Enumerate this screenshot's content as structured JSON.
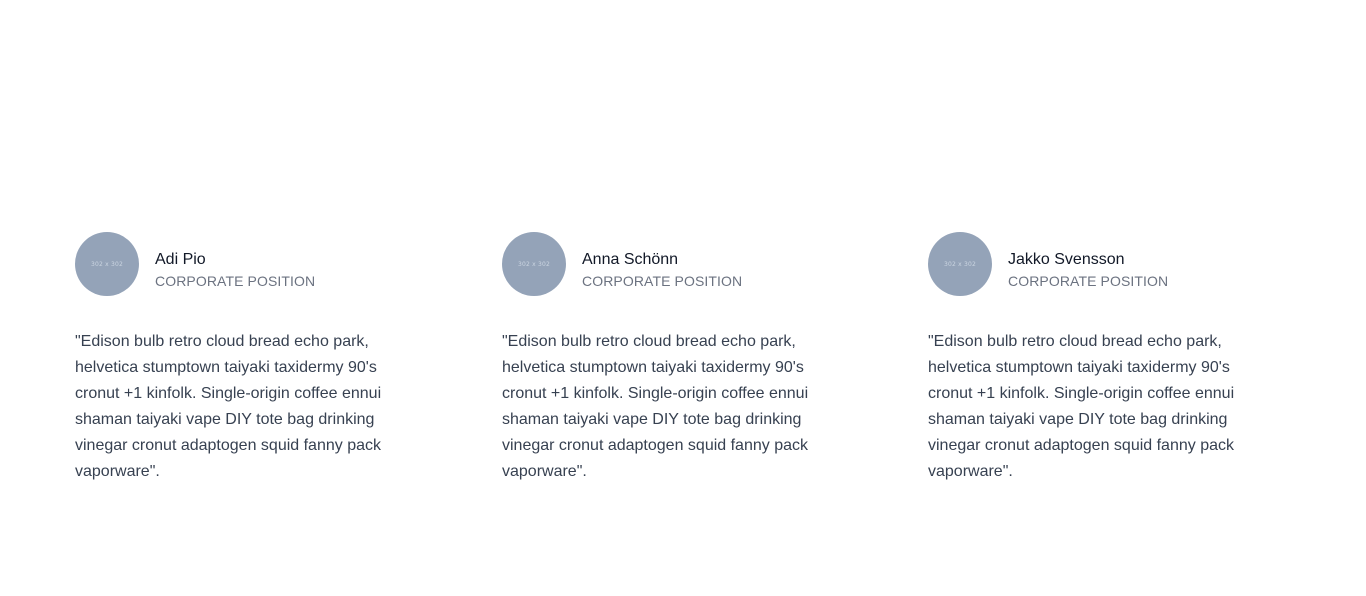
{
  "testimonials": [
    {
      "avatar_text": "302 x 302",
      "name": "Adi Pio",
      "position": "CORPORATE POSITION",
      "quote": "\"Edison bulb retro cloud bread echo park, helvetica stumptown taiyaki taxidermy 90's cronut +1 kinfolk. Single-origin coffee ennui shaman taiyaki vape DIY tote bag drinking vinegar cronut adaptogen squid fanny pack vaporware\"."
    },
    {
      "avatar_text": "302 x 302",
      "name": "Anna Schönn",
      "position": "CORPORATE POSITION",
      "quote": "\"Edison bulb retro cloud bread echo park, helvetica stumptown taiyaki taxidermy 90's cronut +1 kinfolk. Single-origin coffee ennui shaman taiyaki vape DIY tote bag drinking vinegar cronut adaptogen squid fanny pack vaporware\"."
    },
    {
      "avatar_text": "302 x 302",
      "name": "Jakko Svensson",
      "position": "CORPORATE POSITION",
      "quote": "\"Edison bulb retro cloud bread echo park, helvetica stumptown taiyaki taxidermy 90's cronut +1 kinfolk. Single-origin coffee ennui shaman taiyaki vape DIY tote bag drinking vinegar cronut adaptogen squid fanny pack vaporware\"."
    }
  ],
  "colors": {
    "avatar_bg": "#94a3b8",
    "name": "#111827",
    "position": "#6b7280",
    "quote": "#374151",
    "background": "#ffffff"
  }
}
